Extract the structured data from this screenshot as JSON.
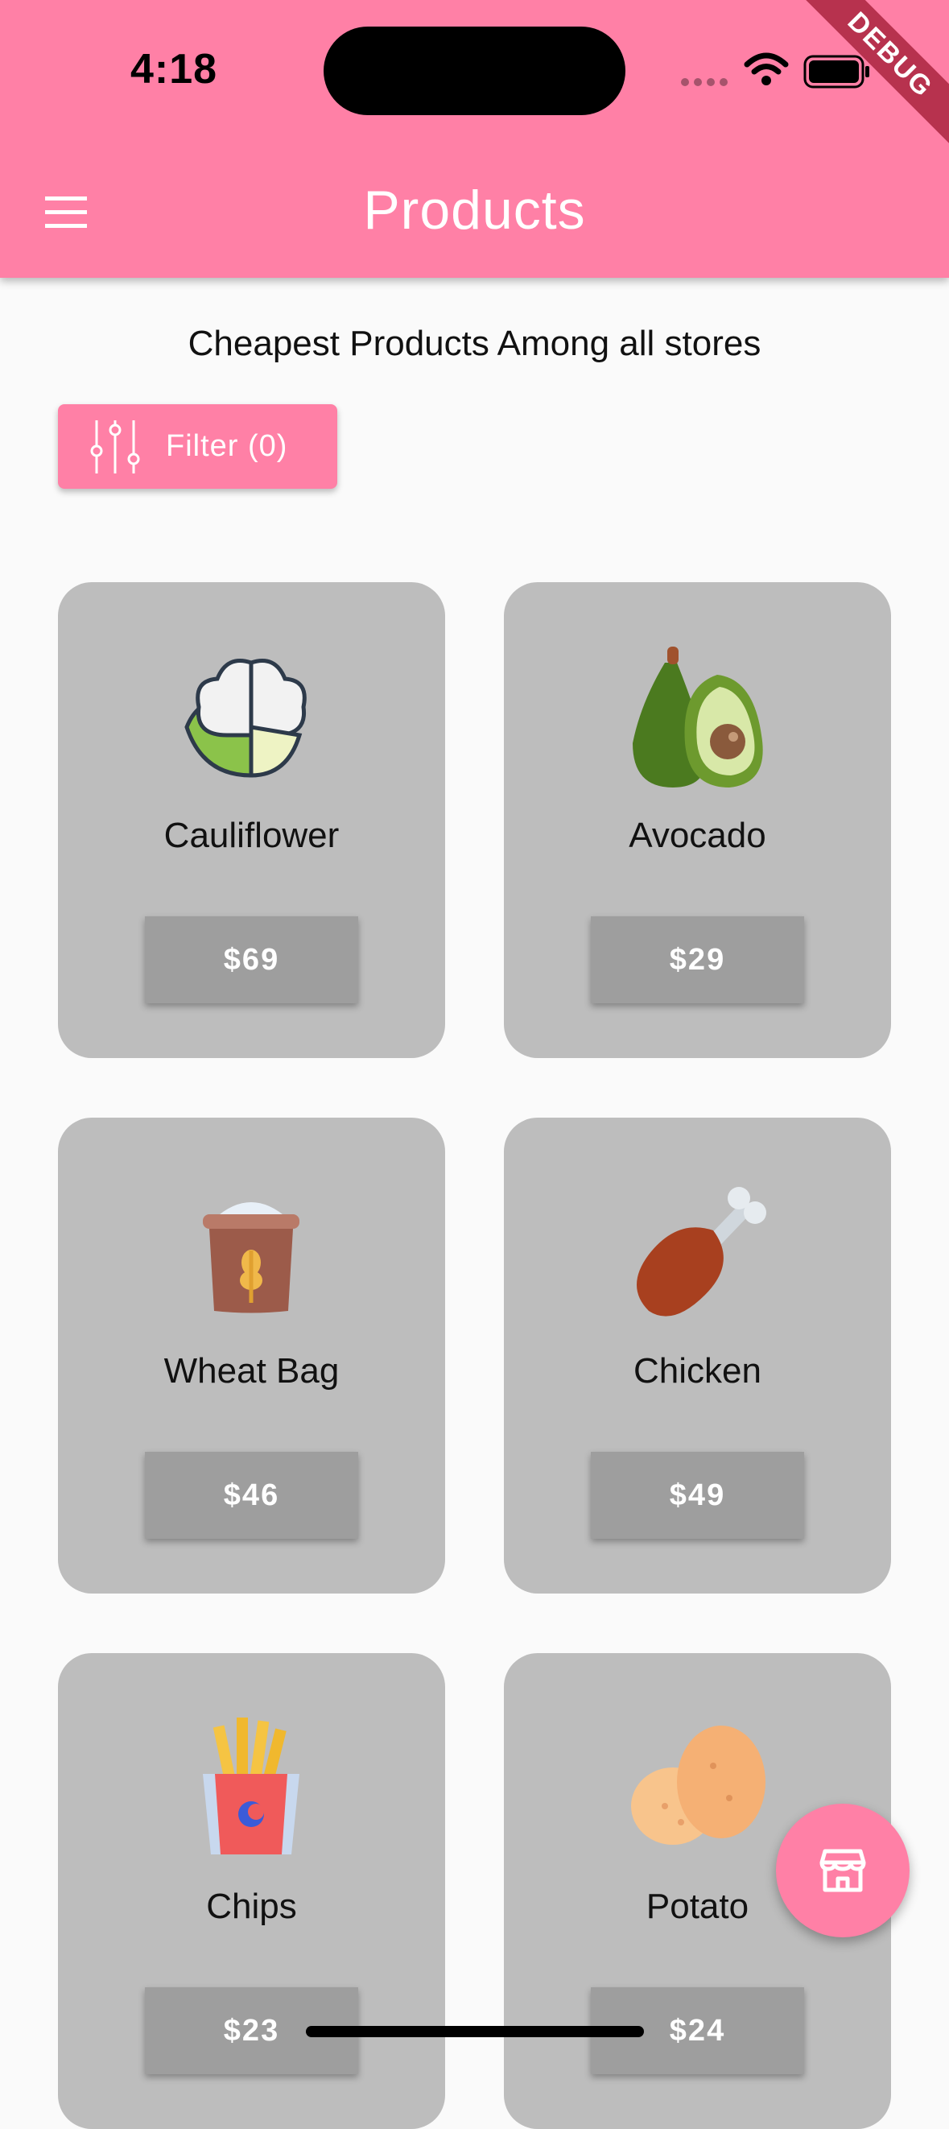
{
  "status_bar": {
    "time": "4:18"
  },
  "debug_banner": "DEBUG",
  "app_bar": {
    "title": "Products"
  },
  "subtitle": "Cheapest Products Among all stores",
  "filter": {
    "label": "Filter (0)"
  },
  "products": [
    {
      "name": "Cauliflower",
      "price": "$69",
      "icon": "cauliflower-icon"
    },
    {
      "name": "Avocado",
      "price": "$29",
      "icon": "avocado-icon"
    },
    {
      "name": "Wheat Bag",
      "price": "$46",
      "icon": "wheat-bag-icon"
    },
    {
      "name": "Chicken",
      "price": "$49",
      "icon": "chicken-leg-icon"
    },
    {
      "name": "Chips",
      "price": "$23",
      "icon": "fries-icon"
    },
    {
      "name": "Potato",
      "price": "$24",
      "icon": "potato-icon"
    }
  ],
  "fab": {
    "icon": "store-icon"
  },
  "colors": {
    "accent": "#ff80a6",
    "card": "#bdbdbd",
    "price_button": "#9e9e9e",
    "background": "#fafafa"
  }
}
